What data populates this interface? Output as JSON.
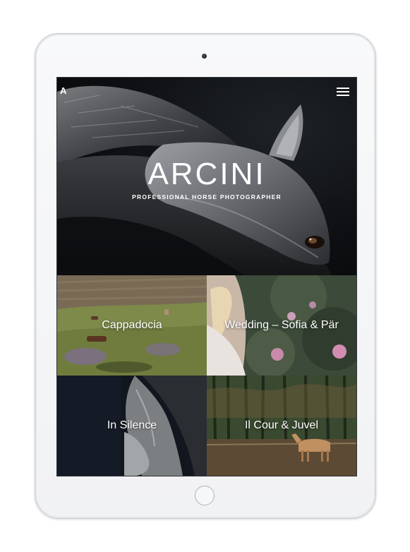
{
  "site": {
    "logo_letter": "A",
    "brand_title": "ARCINI",
    "brand_subtitle": "PROFESSIONAL HORSE PHOTOGRAPHER"
  },
  "header": {
    "menu_icon": "hamburger-menu-icon"
  },
  "gallery": {
    "items": [
      {
        "label": "Cappadocia"
      },
      {
        "label": "Wedding – Sofia & Pär"
      },
      {
        "label": "In Silence"
      },
      {
        "label": "Il Cour & Juvel"
      }
    ]
  },
  "colors": {
    "hero_bg": "#0d0f12",
    "text": "#ffffff",
    "device_frame": "#f4f5f7"
  }
}
